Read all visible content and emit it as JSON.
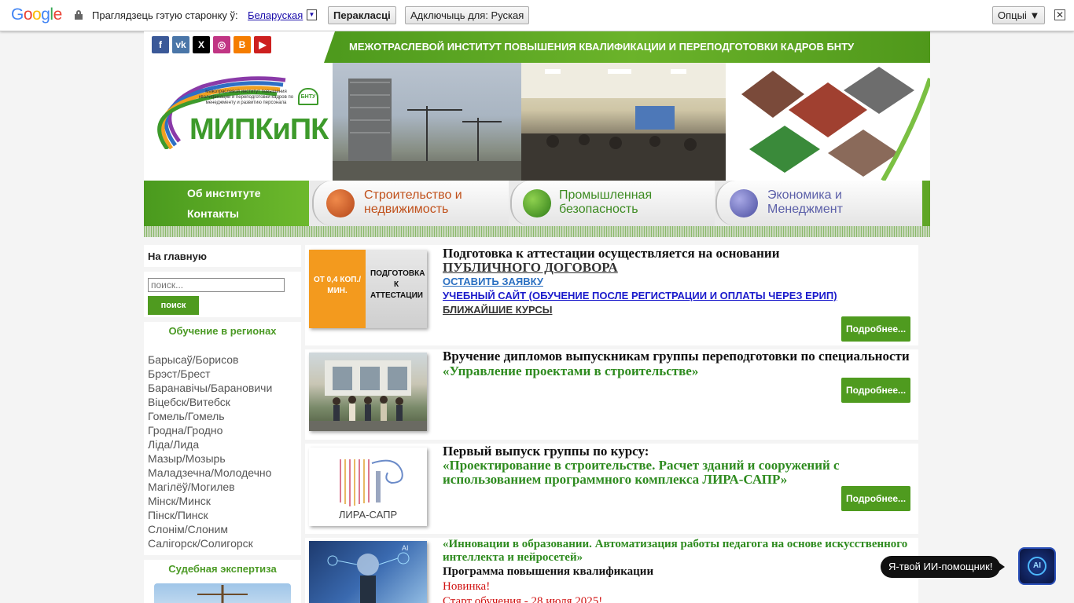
{
  "translate_bar": {
    "logo": "Google",
    "prompt": "Праглядзець гэтую старонку ў:",
    "language": "Беларуская",
    "translate_btn": "Перакласці",
    "disable_btn": "Адключыць для: Руская",
    "options_btn": "Опцыі ▼",
    "close_glyph": "✕"
  },
  "header": {
    "title": "МЕЖОТРАСЛЕВОЙ ИНСТИТУТ ПОВЫШЕНИЯ КВАЛИФИКАЦИИ И ПЕРЕПОДГОТОВКИ КАДРОВ БНТУ",
    "socials": [
      {
        "name": "facebook-icon",
        "glyph": "f",
        "color": "#3b5998"
      },
      {
        "name": "vk-icon",
        "glyph": "vk",
        "color": "#4a76a8"
      },
      {
        "name": "x-icon",
        "glyph": "X",
        "color": "#000000"
      },
      {
        "name": "instagram-icon",
        "glyph": "◎",
        "color": "#c13584"
      },
      {
        "name": "blogger-icon",
        "glyph": "B",
        "color": "#f57d00"
      },
      {
        "name": "youtube-icon",
        "glyph": "▶",
        "color": "#cd201f"
      }
    ],
    "logo_text": "МИПКиПК",
    "logo_small": "межотраслевой институт повышения квалификации и переподготовки кадров по менеджменту и развитию персонала",
    "logo_badge": "БНТУ",
    "nav_left": [
      "Об институте",
      "Контакты"
    ],
    "tabs": [
      {
        "line1": "Строительство и",
        "line2": "недвижимость",
        "color": "#c0501a"
      },
      {
        "line1": "Промышленная",
        "line2": "безопасность",
        "color": "#3d8b22"
      },
      {
        "line1": "Экономика и",
        "line2": "Менеджмент",
        "color": "#5b5fa8"
      }
    ]
  },
  "sidebar": {
    "home": "На главную",
    "search_placeholder": "поиск...",
    "search_btn": "поиск",
    "regions_title": "Обучение в регионах",
    "regions": [
      "Барысаў/Борисов",
      "Брэст/Брест",
      "Баранавічы/Барановичи",
      "Віцебск/Витебск",
      "Гомель/Гомель",
      "Гродна/Гродно",
      "Ліда/Лида",
      "Мазыр/Мозырь",
      "Маладзечна/Молодечно",
      "Магілёў/Могилев",
      "Мінск/Минск",
      "Пінск/Пинск",
      "Слонім/Слоним",
      "Салігорск/Солигорск"
    ],
    "court_title": "Судебная экспертиза"
  },
  "news": {
    "more": "Подробнее...",
    "item1": {
      "thumb_left": "ОТ 0,4 КОП./МИН.",
      "thumb_right": "ПОДГОТОВКА К АТТЕСТАЦИИ",
      "title_a": "Подготовка к аттестации осуществляется на основании",
      "title_b": "ПУБЛИЧНОГО ДОГОВОРА",
      "link1": "ОСТАВИТЬ ЗАЯВКУ",
      "link2": "УЧЕБНЫЙ САЙТ (ОБУЧЕНИЕ ПОСЛЕ РЕГИСТРАЦИИ И ОПЛАТЫ ЧЕРЕЗ ЕРИП)",
      "link3": "БЛИЖАЙШИЕ КУРСЫ"
    },
    "item2": {
      "title_a": "Вручение дипломов выпускникам группы переподготовки по специальности",
      "title_b": "«Управление проектами в строительстве»"
    },
    "item3": {
      "title_a": "Первый выпуск группы по курсу:",
      "title_b": "«Проектирование в строительстве. Расчет зданий и сооружений с использованием программного комплекса ЛИРА-САПР»",
      "thumb_text": "ЛИРА-САПР"
    },
    "item4": {
      "title_green": "«Инновации в образовании. Автоматизация работы педагога на основе искусственного интеллекта и нейросетей»",
      "subtitle": "Программа повышения квалификации",
      "new": "Новинка!",
      "start": "Старт обучения - 28 июля 2025!",
      "thumb_text": "AI"
    }
  },
  "ai_helper": {
    "bubble": "Я-твой ИИ-помощник!",
    "icon": "AI"
  }
}
